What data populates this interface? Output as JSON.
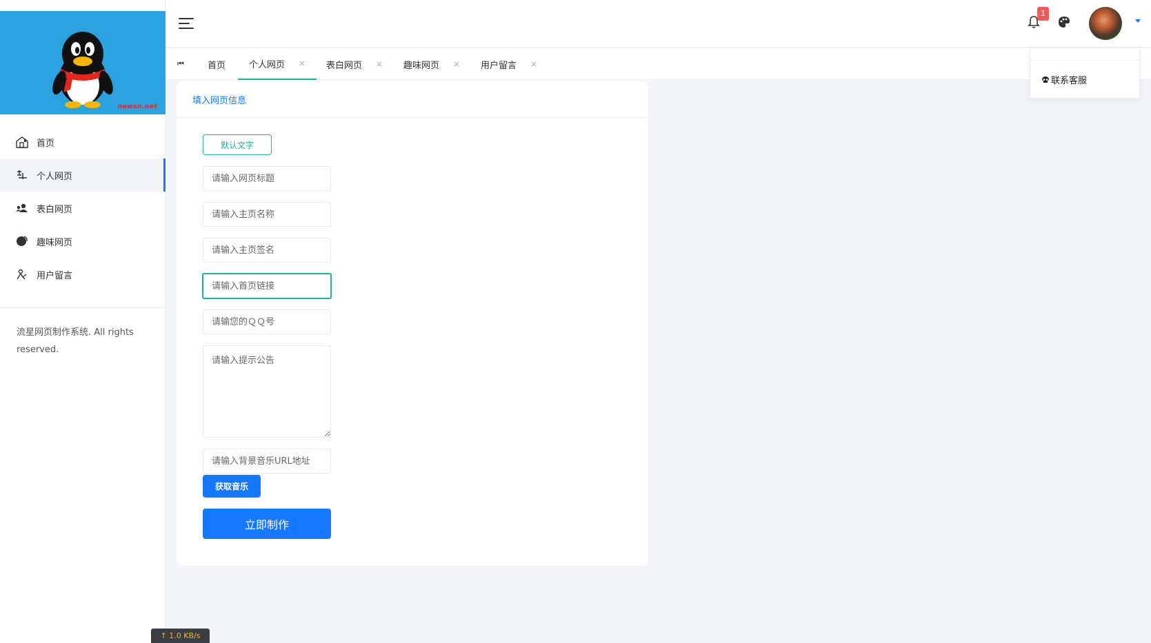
{
  "logo": {
    "tag": "newsn.net"
  },
  "sidebar": {
    "items": [
      {
        "label": "首页",
        "icon": "home-icon"
      },
      {
        "label": "个人网页",
        "icon": "person-page-icon",
        "active": true
      },
      {
        "label": "表白网页",
        "icon": "users-icon"
      },
      {
        "label": "趣味网页",
        "icon": "globe-icon"
      },
      {
        "label": "用户留言",
        "icon": "message-icon"
      }
    ],
    "copyright": "流星网页制作系统. All rights reserved."
  },
  "header": {
    "notification_count": "1",
    "user_menu": {
      "item_label": "联系客服"
    }
  },
  "tabs": {
    "first_icon": "⏮",
    "items": [
      {
        "label": "首页",
        "closable": false
      },
      {
        "label": "个人网页",
        "closable": true,
        "active": true
      },
      {
        "label": "表白网页",
        "closable": true
      },
      {
        "label": "趣味网页",
        "closable": true
      },
      {
        "label": "用户留言",
        "closable": true
      }
    ],
    "close_glyph": "×"
  },
  "form": {
    "title": "填入网页信息",
    "default_text_button": "默认文字",
    "fields": {
      "page_title": "请输入网页标题",
      "home_name": "请输入主页名称",
      "home_signature": "请输入主页签名",
      "home_link": "请输入首页链接",
      "qq_number": "请输您的ＱＱ号",
      "notice": "请输入提示公告",
      "music_url": "请输入背景音乐URL地址"
    },
    "get_music_button": "获取音乐",
    "submit_button": "立即制作"
  },
  "status": {
    "speed": "↑ 1.0 KB/s"
  },
  "colors": {
    "accent": "#1677ff",
    "teal": "#1fb29a",
    "logo_bg": "#2aa2df",
    "badge": "#ef5b5b"
  }
}
